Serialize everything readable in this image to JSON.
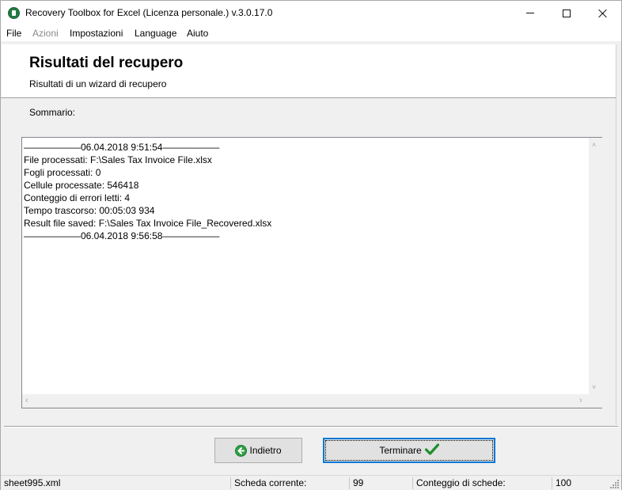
{
  "window": {
    "title": "Recovery Toolbox for Excel (Licenza personale.) v.3.0.17.0"
  },
  "menu": {
    "items": [
      {
        "label": "File",
        "enabled": true
      },
      {
        "label": "Azioni",
        "enabled": false
      },
      {
        "label": "Impostazioni",
        "enabled": true
      },
      {
        "label": "Language",
        "enabled": true
      },
      {
        "label": "Aiuto",
        "enabled": true
      }
    ]
  },
  "header": {
    "title": "Risultati del recupero",
    "subtitle": "Risultati di un wizard di recupero"
  },
  "summary": {
    "label": "Sommario:",
    "lines": [
      "——————06.04.2018 9:51:54——————",
      "File processati: F:\\Sales Tax Invoice File.xlsx",
      "Fogli processati: 0",
      "Cellule processate: 546418",
      "Conteggio di errori letti: 4",
      "Tempo trascorso: 00:05:03 934",
      "Result file saved: F:\\Sales Tax Invoice File_Recovered.xlsx",
      "——————06.04.2018 9:56:58——————"
    ]
  },
  "buttons": {
    "back": "Indietro",
    "finish": "Terminare"
  },
  "statusbar": {
    "file": "sheet995.xml",
    "current_sheet_label": "Scheda corrente:",
    "current_sheet_value": "99",
    "sheet_count_label": "Conteggio di schede:",
    "sheet_count_value": "100"
  },
  "colors": {
    "accent": "#0078d7",
    "check": "#2ea043"
  },
  "icons": {
    "app": "recovery-toolbox-excel-icon",
    "back": "arrow-left-circle-icon",
    "finish": "checkmark-icon"
  }
}
